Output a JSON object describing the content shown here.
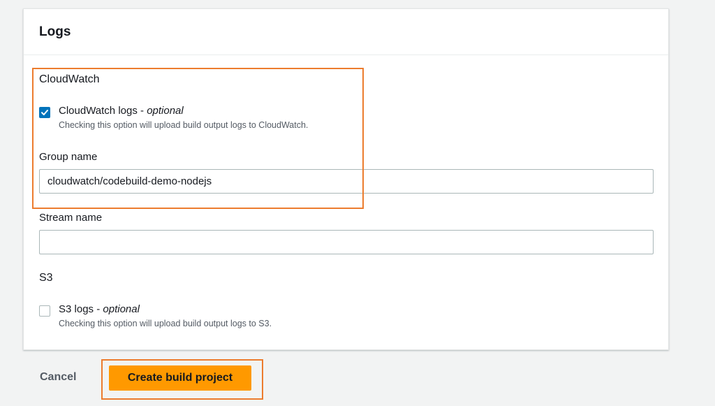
{
  "panel": {
    "title": "Logs"
  },
  "cloudwatch": {
    "section_label": "CloudWatch",
    "checkbox_label": "CloudWatch logs",
    "checkbox_optional": "optional",
    "checkbox_checked": true,
    "checkbox_description": "Checking this option will upload build output logs to CloudWatch.",
    "group_name_label": "Group name",
    "group_name_value": "cloudwatch/codebuild-demo-nodejs",
    "stream_name_label": "Stream name",
    "stream_name_value": ""
  },
  "s3": {
    "section_label": "S3",
    "checkbox_label": "S3 logs",
    "checkbox_optional": "optional",
    "checkbox_checked": false,
    "checkbox_description": "Checking this option will upload build output logs to S3."
  },
  "footer": {
    "cancel_label": "Cancel",
    "create_label": "Create build project"
  },
  "colors": {
    "primary_button": "#ff9900",
    "checkbox_checked": "#0073bb",
    "highlight_annotation": "#ec7c2e"
  }
}
